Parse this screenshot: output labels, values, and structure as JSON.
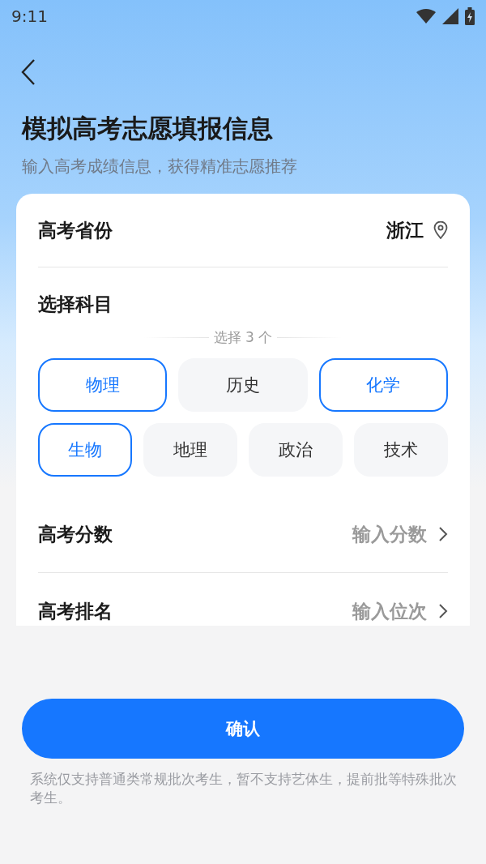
{
  "status_bar": {
    "time": "9:11"
  },
  "header": {
    "title": "模拟高考志愿填报信息",
    "subtitle": "输入高考成绩信息，获得精准志愿推荐"
  },
  "province": {
    "label": "高考省份",
    "value": "浙江"
  },
  "subjects": {
    "label": "选择科目",
    "hint": "选择 3 个",
    "rows": [
      {
        "items": [
          {
            "label": "物理",
            "selected": true
          },
          {
            "label": "历史",
            "selected": false
          },
          {
            "label": "化学",
            "selected": true
          }
        ]
      },
      {
        "items": [
          {
            "label": "生物",
            "selected": true
          },
          {
            "label": "地理",
            "selected": false
          },
          {
            "label": "政治",
            "selected": false
          },
          {
            "label": "技术",
            "selected": false
          }
        ]
      }
    ]
  },
  "inputs": [
    {
      "label": "高考分数",
      "placeholder": "输入分数"
    },
    {
      "label": "高考排名",
      "placeholder": "输入位次"
    }
  ],
  "confirm_button": "确认",
  "note": "系统仅支持普通类常规批次考生，暂不支持艺体生，提前批等特殊批次考生。"
}
